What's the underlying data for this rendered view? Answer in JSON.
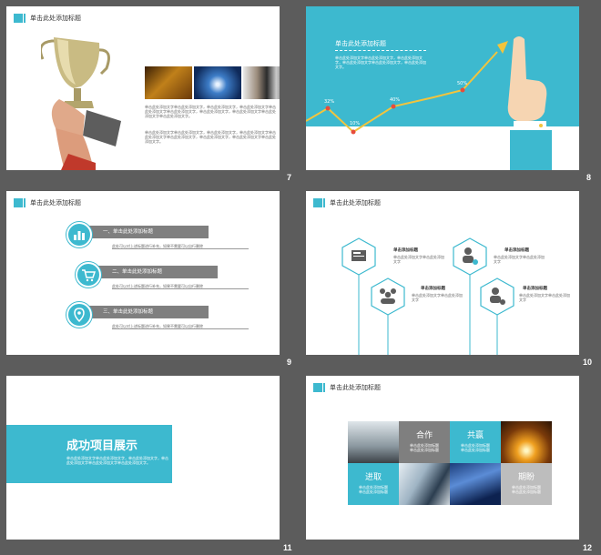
{
  "colors": {
    "accent": "#3db9cf",
    "dark": "#5c5c5c",
    "gray_bar": "#7f7f7f",
    "arrow": "#f2c43d"
  },
  "slides": [
    {
      "number": "7",
      "title": "单击此处添加标题",
      "body": "单击此处添加文字单击此处添加文字，单击此处添加文字，单击此处添加文字单击此处添加文字单击此处添加文字，单击此处添加文字，单击此处添加文字单击此处添加文字单击此处添加文字。",
      "body2": "单击此处添加文字单击此处添加文字，单击此处添加文字，单击此处添加文字单击此处添加文字单击此处添加文字，单击此处添加文字，单击此处添加文字单击此处添加文字。"
    },
    {
      "number": "8",
      "title": "单击此处添加标题",
      "body": "单击此处添加文字单击此处添加文字，单击此处添加文字，单击此处添加文字单击此处添加文字，单击此处添加文字。",
      "points": [
        "32%",
        "10%",
        "40%",
        "50%"
      ]
    },
    {
      "number": "9",
      "title": "单击此处添加标题",
      "items": [
        {
          "label": "一、单击此处添加标题",
          "desc": "此处可以对上述标题进行补充，如果不需要可以自行删除"
        },
        {
          "label": "二、单击此处添加标题",
          "desc": "此处可以对上述标题进行补充，如果不需要可以自行删除"
        },
        {
          "label": "三、单击此处添加标题",
          "desc": "此处可以对上述标题进行补充，如果不需要可以自行删除"
        }
      ]
    },
    {
      "number": "10",
      "title": "单击此处添加标题",
      "nodes": [
        {
          "title": "单击添加标题",
          "desc": "单击此处添加文字单击此处添加文字"
        },
        {
          "title": "单击添加标题",
          "desc": "单击此处添加文字单击此处添加文字"
        },
        {
          "title": "单击添加标题",
          "desc": "单击此处添加文字单击此处添加文字"
        },
        {
          "title": "单击添加标题",
          "desc": "单击此处添加文字单击此处添加文字"
        }
      ]
    },
    {
      "number": "11",
      "title": "成功项目展示",
      "body": "单击此处添加文字单击此处添加文字，单击此处添加文字，单击此处添加文字单击此处添加文字单击此处添加文字。"
    },
    {
      "number": "12",
      "title": "单击此处添加标题",
      "tiles": [
        {
          "label": "合作",
          "desc": "单击此处添加标题\n单击此处添加标题"
        },
        {
          "label": "共赢",
          "desc": "单击此处添加标题\n单击此处添加标题"
        },
        {
          "label": "进取",
          "desc": "单击此处添加标题\n单击此处添加标题"
        },
        {
          "label": "期盼",
          "desc": "单击此处添加标题\n单击此处添加标题"
        }
      ]
    }
  ]
}
